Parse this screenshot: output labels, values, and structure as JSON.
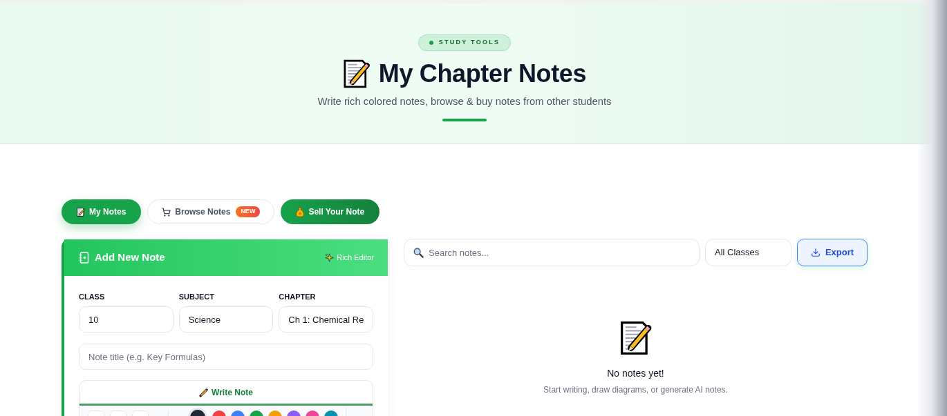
{
  "header": {
    "badge": "STUDY TOOLS",
    "title": "My Chapter Notes",
    "subtitle": "Write rich colored notes, browse & buy notes from other students"
  },
  "tabs": [
    {
      "label": "My Notes",
      "selected": true
    },
    {
      "label": "Browse Notes",
      "selected": false,
      "badge": "NEW"
    }
  ],
  "sell_button": {
    "label": "Sell Your Note"
  },
  "add_note": {
    "title": "Add New Note",
    "editor_tag": "Rich Editor",
    "fields": [
      {
        "label": "CLASS",
        "value": "10"
      },
      {
        "label": "SUBJECT",
        "value": "Science"
      },
      {
        "label": "CHAPTER",
        "value": "Ch 1: Chemical Re"
      }
    ],
    "note_title": {
      "placeholder": "Note title (e.g. Key Formulas)"
    },
    "editor": {
      "tabs": [
        {
          "label": "Write Note",
          "selected": true
        }
      ],
      "colors": [
        {
          "color": "#1f2937",
          "selected": true
        },
        {
          "color": "#ef4444",
          "selected": false
        },
        {
          "color": "#3b82f6",
          "selected": false
        },
        {
          "color": "#16a34a",
          "selected": false
        },
        {
          "color": "#f59e0b",
          "selected": false
        },
        {
          "color": "#8b5cf6",
          "selected": false
        },
        {
          "color": "#ec4899",
          "selected": false
        },
        {
          "color": "#0891b2",
          "selected": false
        }
      ]
    }
  },
  "notes_panel": {
    "search": {
      "placeholder": "Search notes..."
    },
    "class_filter": {
      "value": "All Classes"
    },
    "export_button": {
      "label": "Export"
    },
    "empty_state": {
      "title": "No notes yet!",
      "message": "Start writing, draw diagrams, or generate AI notes."
    }
  }
}
